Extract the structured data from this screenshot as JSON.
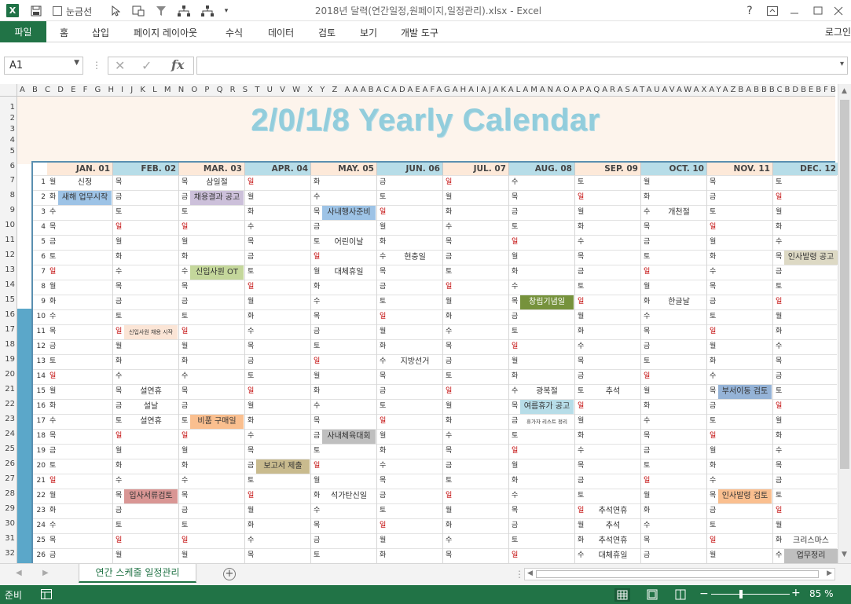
{
  "titlebar": {
    "title": "2018년 달력(연간일정,원페이지,일정관리).xlsx - Excel",
    "gridlines_label": "눈금선",
    "help": "?",
    "logo": "X"
  },
  "ribbon": {
    "tabs": [
      "파일",
      "홈",
      "삽입",
      "페이지 레이아웃",
      "수식",
      "데이터",
      "검토",
      "보기",
      "개발 도구"
    ],
    "login": "로그인"
  },
  "formula": {
    "namebox": "A1",
    "fx": "fx",
    "value": ""
  },
  "columns": "A B C D E F G H I J K L M N O P Q R S T U V W X Y Z AAABACADAEAFAGAHAIAJAKALAMANAOAPAQARASATAUAVAWAXAYAZBABBBCBDBEBFBGBHBIBJBKBLBMBNBOBPBQBRBSBTBUB",
  "rows": [
    "1",
    "2",
    "3",
    "4",
    "5",
    "6",
    "7",
    "8",
    "9",
    "10",
    "11",
    "12",
    "13",
    "14",
    "15",
    "16",
    "17",
    "18",
    "19",
    "20",
    "21",
    "22",
    "23",
    "24",
    "25",
    "26",
    "27",
    "28",
    "29",
    "30",
    "31",
    "32"
  ],
  "calendar": {
    "title": "2/0/1/8 Yearly Calendar",
    "months": [
      "JAN. 01",
      "FEB. 02",
      "MAR. 03",
      "APR. 04",
      "MAY. 05",
      "JUN. 06",
      "JUL. 07",
      "AUG. 08",
      "SEP. 09",
      "OCT. 10",
      "NOV. 11",
      "DEC. 12"
    ],
    "days": [
      "1",
      "2",
      "3",
      "4",
      "5",
      "6",
      "7",
      "8",
      "9",
      "10",
      "11",
      "12",
      "13",
      "14",
      "15",
      "16",
      "17",
      "18",
      "19",
      "20",
      "21",
      "22",
      "23",
      "24",
      "25",
      "26"
    ],
    "weekdays": [
      [
        "월",
        "화",
        "수",
        "목",
        "금",
        "토",
        "일",
        "월",
        "화",
        "수",
        "목",
        "금",
        "토",
        "일",
        "월",
        "화",
        "수",
        "목",
        "금",
        "토",
        "일",
        "월",
        "화",
        "수",
        "목",
        "금"
      ],
      [
        "목",
        "금",
        "토",
        "일",
        "월",
        "화",
        "수",
        "목",
        "금",
        "토",
        "일",
        "월",
        "화",
        "수",
        "목",
        "금",
        "토",
        "일",
        "월",
        "화",
        "수",
        "목",
        "금",
        "토",
        "일",
        "월"
      ],
      [
        "목",
        "금",
        "토",
        "일",
        "월",
        "화",
        "수",
        "목",
        "금",
        "토",
        "일",
        "월",
        "화",
        "수",
        "목",
        "금",
        "토",
        "일",
        "월",
        "화",
        "수",
        "목",
        "금",
        "토",
        "일",
        "월"
      ],
      [
        "일",
        "월",
        "화",
        "수",
        "목",
        "금",
        "토",
        "일",
        "월",
        "화",
        "수",
        "목",
        "금",
        "토",
        "일",
        "월",
        "화",
        "수",
        "목",
        "금",
        "토",
        "일",
        "월",
        "화",
        "수",
        "목"
      ],
      [
        "화",
        "수",
        "목",
        "금",
        "토",
        "일",
        "월",
        "화",
        "수",
        "목",
        "금",
        "토",
        "일",
        "월",
        "화",
        "수",
        "목",
        "금",
        "토",
        "일",
        "월",
        "화",
        "수",
        "목",
        "금",
        "토"
      ],
      [
        "금",
        "토",
        "일",
        "월",
        "화",
        "수",
        "목",
        "금",
        "토",
        "일",
        "월",
        "화",
        "수",
        "목",
        "금",
        "토",
        "일",
        "월",
        "화",
        "수",
        "목",
        "금",
        "토",
        "일",
        "월",
        "화"
      ],
      [
        "일",
        "월",
        "화",
        "수",
        "목",
        "금",
        "토",
        "일",
        "월",
        "화",
        "수",
        "목",
        "금",
        "토",
        "일",
        "월",
        "화",
        "수",
        "목",
        "금",
        "토",
        "일",
        "월",
        "화",
        "수",
        "목"
      ],
      [
        "수",
        "목",
        "금",
        "토",
        "일",
        "월",
        "화",
        "수",
        "목",
        "금",
        "토",
        "일",
        "월",
        "화",
        "수",
        "목",
        "금",
        "토",
        "일",
        "월",
        "화",
        "수",
        "목",
        "금",
        "토",
        "일"
      ],
      [
        "토",
        "일",
        "월",
        "화",
        "수",
        "목",
        "금",
        "토",
        "일",
        "월",
        "화",
        "수",
        "목",
        "금",
        "토",
        "일",
        "월",
        "화",
        "수",
        "목",
        "금",
        "토",
        "일",
        "월",
        "화",
        "수"
      ],
      [
        "월",
        "화",
        "수",
        "목",
        "금",
        "토",
        "일",
        "월",
        "화",
        "수",
        "목",
        "금",
        "토",
        "일",
        "월",
        "화",
        "수",
        "목",
        "금",
        "토",
        "일",
        "월",
        "화",
        "수",
        "목",
        "금"
      ],
      [
        "목",
        "금",
        "토",
        "일",
        "월",
        "화",
        "수",
        "목",
        "금",
        "토",
        "일",
        "월",
        "화",
        "수",
        "목",
        "금",
        "토",
        "일",
        "월",
        "화",
        "수",
        "목",
        "금",
        "토",
        "일",
        "월"
      ],
      [
        "토",
        "일",
        "월",
        "화",
        "수",
        "목",
        "금",
        "토",
        "일",
        "월",
        "화",
        "수",
        "목",
        "금",
        "토",
        "일",
        "월",
        "화",
        "수",
        "목",
        "금",
        "토",
        "일",
        "월",
        "화",
        "수"
      ]
    ],
    "events": [
      {
        "m": 0,
        "d": 0,
        "text": "신정",
        "style": "plain"
      },
      {
        "m": 0,
        "d": 1,
        "text": "새해 업무시작",
        "style": "blue"
      },
      {
        "m": 1,
        "d": 10,
        "text": "신입사원 채용 시작",
        "style": "peach"
      },
      {
        "m": 1,
        "d": 14,
        "text": "설연휴",
        "style": "plain"
      },
      {
        "m": 1,
        "d": 15,
        "text": "설날",
        "style": "plain"
      },
      {
        "m": 1,
        "d": 16,
        "text": "설연휴",
        "style": "plain"
      },
      {
        "m": 1,
        "d": 21,
        "text": "입사서류검토",
        "style": "rose"
      },
      {
        "m": 2,
        "d": 0,
        "text": "삼일절",
        "style": "plain"
      },
      {
        "m": 2,
        "d": 1,
        "text": "채용결과 공고",
        "style": "lavender"
      },
      {
        "m": 2,
        "d": 6,
        "text": "신입사원 OT",
        "style": "green"
      },
      {
        "m": 2,
        "d": 16,
        "text": "비품 구매일",
        "style": "orange"
      },
      {
        "m": 3,
        "d": 19,
        "text": "보고서 제출",
        "style": "khaki"
      },
      {
        "m": 4,
        "d": 2,
        "text": "사내행사준비",
        "style": "blue"
      },
      {
        "m": 4,
        "d": 4,
        "text": "어린이날",
        "style": "plain"
      },
      {
        "m": 4,
        "d": 6,
        "text": "대체휴일",
        "style": "plain"
      },
      {
        "m": 4,
        "d": 17,
        "text": "사내체육대회",
        "style": "gray"
      },
      {
        "m": 4,
        "d": 21,
        "text": "석가탄신일",
        "style": "plain"
      },
      {
        "m": 5,
        "d": 5,
        "text": "현충일",
        "style": "plain"
      },
      {
        "m": 5,
        "d": 12,
        "text": "지방선거",
        "style": "plain"
      },
      {
        "m": 7,
        "d": 8,
        "text": "창립기념일",
        "style": "olive"
      },
      {
        "m": 7,
        "d": 14,
        "text": "광복절",
        "style": "plain"
      },
      {
        "m": 7,
        "d": 15,
        "text": "여름휴가 공고",
        "style": "sky"
      },
      {
        "m": 7,
        "d": 16,
        "text": "휴가자 리스트 정리",
        "style": "tiny"
      },
      {
        "m": 8,
        "d": 14,
        "text": "추석",
        "style": "plain"
      },
      {
        "m": 8,
        "d": 22,
        "text": "추석연휴",
        "style": "plain"
      },
      {
        "m": 8,
        "d": 23,
        "text": "추석",
        "style": "plain"
      },
      {
        "m": 8,
        "d": 24,
        "text": "추석연휴",
        "style": "plain"
      },
      {
        "m": 8,
        "d": 25,
        "text": "대체휴일",
        "style": "plain"
      },
      {
        "m": 9,
        "d": 2,
        "text": "개천절",
        "style": "plain"
      },
      {
        "m": 9,
        "d": 8,
        "text": "한글날",
        "style": "plain"
      },
      {
        "m": 10,
        "d": 14,
        "text": "부서이동 검토",
        "style": "steel"
      },
      {
        "m": 10,
        "d": 21,
        "text": "인사발령 검토",
        "style": "orange"
      },
      {
        "m": 11,
        "d": 5,
        "text": "인사발령 공고",
        "style": "tan"
      },
      {
        "m": 11,
        "d": 24,
        "text": "크리스마스",
        "style": "plain"
      },
      {
        "m": 11,
        "d": 25,
        "text": "업무정리",
        "style": "gray"
      }
    ]
  },
  "sheet_tab": "연간 스케줄 일정관리",
  "status": {
    "ready": "준비",
    "zoom": "85 %"
  },
  "colors": {
    "excel_green": "#217346",
    "title_blue": "#92cddc",
    "sunday_red": "#c00000",
    "header_blue": "#b7dde8",
    "header_peach": "#fde9d9"
  }
}
